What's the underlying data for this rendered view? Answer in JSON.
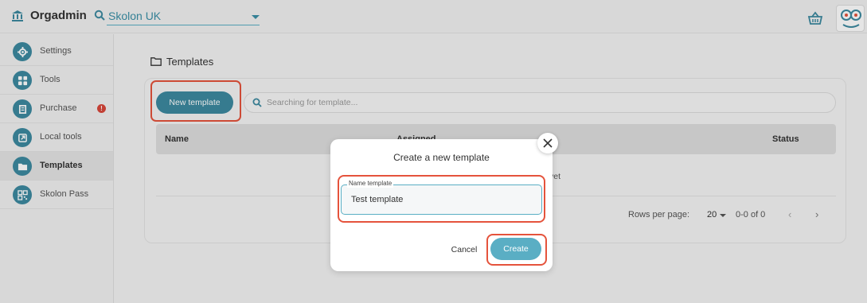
{
  "header": {
    "app_name": "Orgadmin",
    "org_select_value": "Skolon UK",
    "icons": {
      "org": "institution-icon",
      "search": "search-icon",
      "basket": "basket-icon",
      "avatar": "face-avatar-icon"
    }
  },
  "sidebar": {
    "items": [
      {
        "label": "Settings",
        "icon": "gear-icon"
      },
      {
        "label": "Tools",
        "icon": "grid-icon"
      },
      {
        "label": "Purchase",
        "icon": "book-icon",
        "badge": "!"
      },
      {
        "label": "Local tools",
        "icon": "arrow-out-icon"
      },
      {
        "label": "Templates",
        "icon": "folder-icon",
        "active": true
      },
      {
        "label": "Skolon Pass",
        "icon": "qr-icon"
      }
    ]
  },
  "main": {
    "title": "Templates",
    "new_template_label": "New template",
    "search_placeholder": "Searching for template...",
    "table": {
      "columns": [
        "Name",
        "Assigned",
        "Status"
      ],
      "empty_fragment": "yet"
    },
    "pagination": {
      "rows_per_page_label": "Rows per page:",
      "rows_per_page_value": "20",
      "range": "0-0 of 0"
    }
  },
  "dialog": {
    "title": "Create a new template",
    "field_label": "Name template",
    "field_value": "Test template",
    "cancel_label": "Cancel",
    "create_label": "Create"
  },
  "colors": {
    "accent": "#3d8aa0",
    "accent_light": "#5aaec4",
    "highlight": "#e5533c",
    "badge": "#d9473a"
  }
}
